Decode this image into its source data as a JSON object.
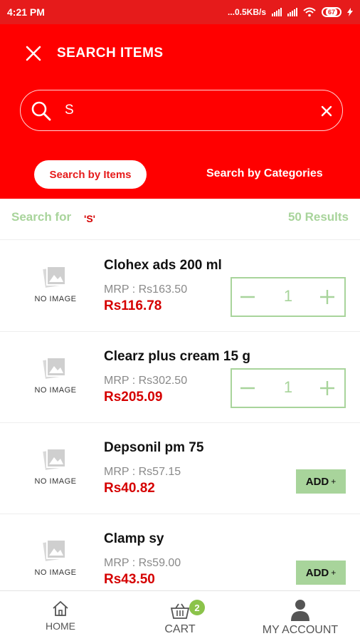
{
  "status_bar": {
    "time": "4:21 PM",
    "network_speed": "...0.5KB/s",
    "battery": "67"
  },
  "header": {
    "title": "SEARCH ITEMS",
    "search_value": "S",
    "tabs": {
      "active": "Search by Items",
      "inactive": "Search by Categories"
    }
  },
  "results": {
    "search_for_label": "Search for",
    "search_term": "'S'",
    "count_text": "50 Results"
  },
  "products": [
    {
      "name": "Clohex ads 200 ml",
      "mrp_label": "MRP :",
      "mrp": "Rs163.50",
      "price": "Rs116.78",
      "quantity": "1",
      "control": "stepper",
      "image_placeholder": "NO IMAGE"
    },
    {
      "name": "Clearz plus cream 15 g",
      "mrp_label": "MRP :",
      "mrp": "Rs302.50",
      "price": "Rs205.09",
      "quantity": "1",
      "control": "stepper",
      "image_placeholder": "NO IMAGE"
    },
    {
      "name": "Depsonil pm 75",
      "mrp_label": "MRP :",
      "mrp": "Rs57.15",
      "price": "Rs40.82",
      "add_label": "ADD",
      "control": "add",
      "image_placeholder": "NO IMAGE"
    },
    {
      "name": "Clamp sy",
      "mrp_label": "MRP :",
      "mrp": "Rs59.00",
      "price": "Rs43.50",
      "add_label": "ADD",
      "control": "add",
      "image_placeholder": "NO IMAGE"
    }
  ],
  "bottom_nav": {
    "home": "HOME",
    "cart": "CART",
    "cart_count": "2",
    "account": "MY ACCOUNT"
  },
  "colors": {
    "primary": "#ff0000",
    "accent_green": "#a8d49b",
    "price_red": "#d50000",
    "badge_green": "#8bc34a"
  },
  "icons": [
    "close-icon",
    "search-icon",
    "clear-icon",
    "no-image-icon",
    "minus-icon",
    "plus-icon",
    "home-icon",
    "cart-icon",
    "account-icon"
  ]
}
